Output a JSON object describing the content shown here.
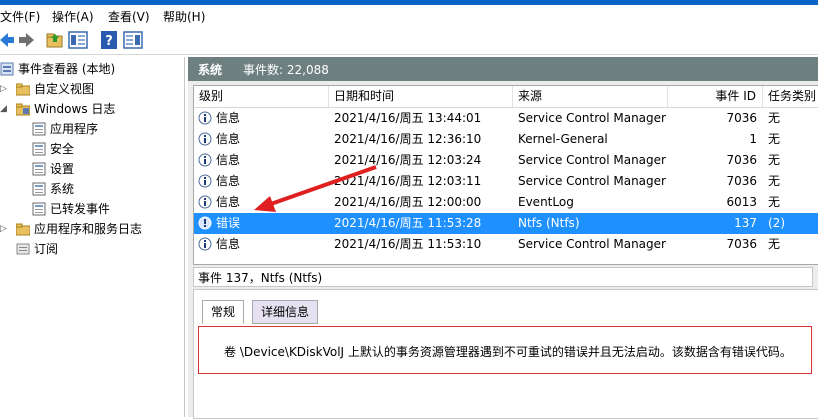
{
  "menu": [
    "文件(F)",
    "操作(A)",
    "查看(V)",
    "帮助(H)"
  ],
  "tree": {
    "root": "事件查看器 (本地)",
    "custom_views": "自定义视图",
    "windows_logs": "Windows 日志",
    "logs": [
      "应用程序",
      "安全",
      "设置",
      "系统",
      "已转发事件"
    ],
    "app_service_logs": "应用程序和服务日志",
    "subscriptions": "订阅"
  },
  "pane": {
    "title": "系统",
    "event_count": "事件数: 22,088"
  },
  "columns": [
    "级别",
    "日期和时间",
    "来源",
    "事件 ID",
    "任务类别"
  ],
  "events": [
    {
      "level": "信息",
      "datetime": "2021/4/16/周五 13:44:01",
      "source": "Service Control Manager",
      "id": "7036",
      "task": "无"
    },
    {
      "level": "信息",
      "datetime": "2021/4/16/周五 12:36:10",
      "source": "Kernel-General",
      "id": "1",
      "task": "无"
    },
    {
      "level": "信息",
      "datetime": "2021/4/16/周五 12:03:24",
      "source": "Service Control Manager",
      "id": "7036",
      "task": "无"
    },
    {
      "level": "信息",
      "datetime": "2021/4/16/周五 12:03:11",
      "source": "Service Control Manager",
      "id": "7036",
      "task": "无"
    },
    {
      "level": "信息",
      "datetime": "2021/4/16/周五 12:00:00",
      "source": "EventLog",
      "id": "6013",
      "task": "无"
    },
    {
      "level": "错误",
      "datetime": "2021/4/16/周五 11:53:28",
      "source": "Ntfs (Ntfs)",
      "id": "137",
      "task": "(2)"
    },
    {
      "level": "信息",
      "datetime": "2021/4/16/周五 11:53:10",
      "source": "Service Control Manager",
      "id": "7036",
      "task": "无"
    }
  ],
  "detail": {
    "title": "事件 137，Ntfs (Ntfs)",
    "tabs": [
      "常规",
      "详细信息"
    ],
    "message": "卷 \\Device\\KDiskVolJ 上默认的事务资源管理器遇到不可重试的错误并且无法启动。该数据含有错误代码。"
  },
  "colors": {
    "selected": "#1e90ff",
    "header": "#6e7f80",
    "annotation": "#e02020"
  }
}
